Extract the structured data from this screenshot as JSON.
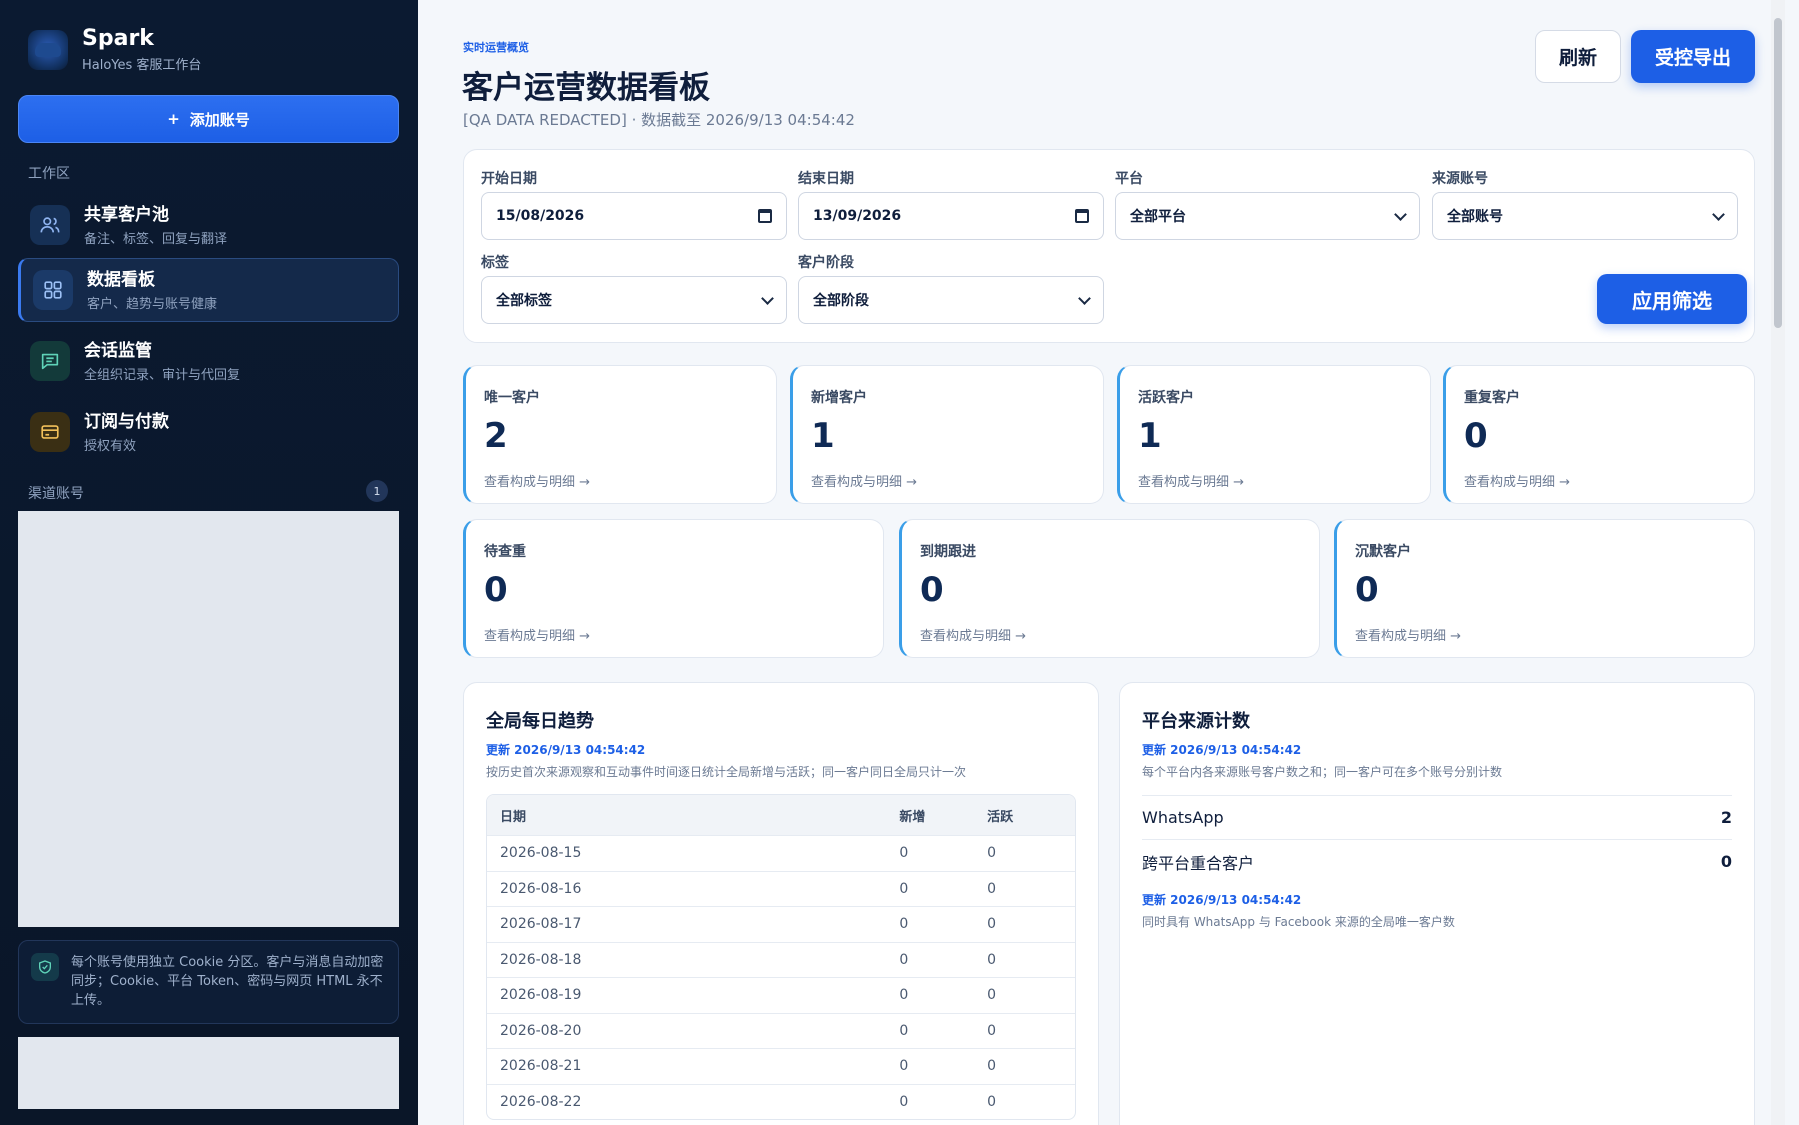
{
  "brand": {
    "name": "Spark",
    "subtitle": "HaloYes 客服工作台"
  },
  "sidebar": {
    "add_account": "添加账号",
    "add_icon": "+",
    "workspace_label": "工作区",
    "items": [
      {
        "title": "共享客户池",
        "subtitle": "备注、标签、回复与翻译",
        "icon": "users-icon"
      },
      {
        "title": "数据看板",
        "subtitle": "客户、趋势与账号健康",
        "icon": "grid-icon"
      },
      {
        "title": "会话监管",
        "subtitle": "全组织记录、审计与代回复",
        "icon": "chat-icon"
      },
      {
        "title": "订阅与付款",
        "subtitle": "授权有效",
        "icon": "card-icon"
      }
    ],
    "channels_label": "渠道账号",
    "channels_count": "1",
    "notice": "每个账号使用独立 Cookie 分区。客户与消息自动加密同步；Cookie、平台 Token、密码与网页 HTML 永不上传。"
  },
  "header": {
    "eyebrow": "实时运营概览",
    "title": "客户运营数据看板",
    "subtitle": "[QA DATA REDACTED] · 数据截至 2026/9/13 04:54:42",
    "refresh": "刷新",
    "export": "受控导出"
  },
  "filters": {
    "start_label": "开始日期",
    "start_value": "15/08/2026",
    "end_label": "结束日期",
    "end_value": "13/09/2026",
    "platform_label": "平台",
    "platform_value": "全部平台",
    "source_label": "来源账号",
    "source_value": "全部账号",
    "tag_label": "标签",
    "tag_value": "全部标签",
    "stage_label": "客户阶段",
    "stage_value": "全部阶段",
    "apply": "应用筛选"
  },
  "stats_link": "查看构成与明细 →",
  "stats": [
    {
      "label": "唯一客户",
      "value": "2"
    },
    {
      "label": "新增客户",
      "value": "1"
    },
    {
      "label": "活跃客户",
      "value": "1"
    },
    {
      "label": "重复客户",
      "value": "0"
    },
    {
      "label": "待查重",
      "value": "0"
    },
    {
      "label": "到期跟进",
      "value": "0"
    },
    {
      "label": "沉默客户",
      "value": "0"
    }
  ],
  "trend": {
    "title": "全局每日趋势",
    "updated": "更新 2026/9/13 04:54:42",
    "desc": "按历史首次来源观察和互动事件时间逐日统计全局新增与活跃；同一客户同日全局只计一次",
    "columns": [
      "日期",
      "新增",
      "活跃"
    ],
    "rows": [
      [
        "2026-08-15",
        "0",
        "0"
      ],
      [
        "2026-08-16",
        "0",
        "0"
      ],
      [
        "2026-08-17",
        "0",
        "0"
      ],
      [
        "2026-08-18",
        "0",
        "0"
      ],
      [
        "2026-08-19",
        "0",
        "0"
      ],
      [
        "2026-08-20",
        "0",
        "0"
      ],
      [
        "2026-08-21",
        "0",
        "0"
      ],
      [
        "2026-08-22",
        "0",
        "0"
      ]
    ]
  },
  "sources": {
    "title": "平台来源计数",
    "updated": "更新 2026/9/13 04:54:42",
    "desc": "每个平台内各来源账号客户数之和；同一客户可在多个账号分别计数",
    "rows": [
      {
        "label": "WhatsApp",
        "value": "2"
      },
      {
        "label": "跨平台重合客户",
        "value": "0"
      }
    ],
    "updated2": "更新 2026/9/13 04:54:42",
    "desc2": "同时具有 WhatsApp 与 Facebook 来源的全局唯一客户数"
  }
}
